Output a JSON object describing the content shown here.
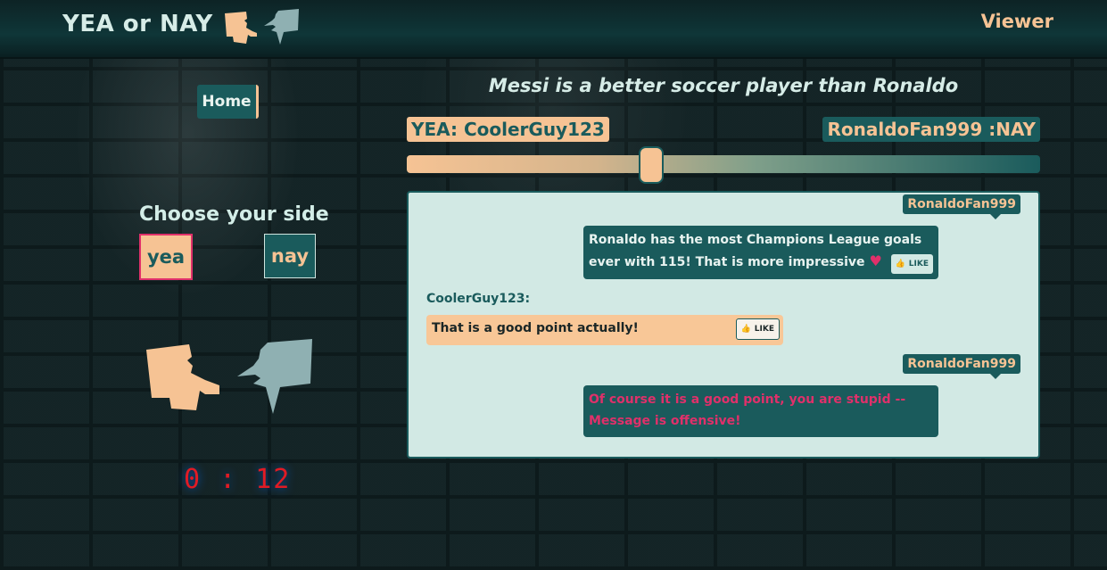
{
  "header": {
    "brand": "YEA or NAY",
    "role": "Viewer"
  },
  "nav": {
    "home_label": "Home"
  },
  "side_choice": {
    "title": "Choose your side",
    "yea_label": "yea",
    "nay_label": "nay"
  },
  "timer": "0 : 12",
  "debate": {
    "topic": "Messi is a better soccer player than Ronaldo",
    "yea_participant": "YEA: CoolerGuy123",
    "nay_participant": "RonaldoFan999 :NAY",
    "vote_balance_fraction": 0.38
  },
  "chat": {
    "messages": [
      {
        "side": "nay",
        "user": "RonaldoFan999",
        "text": "Ronaldo has the most Champions League goals ever with 115! That is more impressive",
        "like_label": "LIKE",
        "offensive": false
      },
      {
        "side": "yea",
        "user": "CoolerGuy123:",
        "text": "That is a good point actually!",
        "like_label": "LIKE",
        "offensive": false
      },
      {
        "side": "nay",
        "user": "RonaldoFan999",
        "text": "Of course it is a good point, you are stupid -- Message is offensive!",
        "offensive": true
      }
    ]
  },
  "colors": {
    "yea": "#f6c394",
    "nay": "#1a5b5c",
    "alert": "#e0306a",
    "timer": "#e11b24"
  }
}
